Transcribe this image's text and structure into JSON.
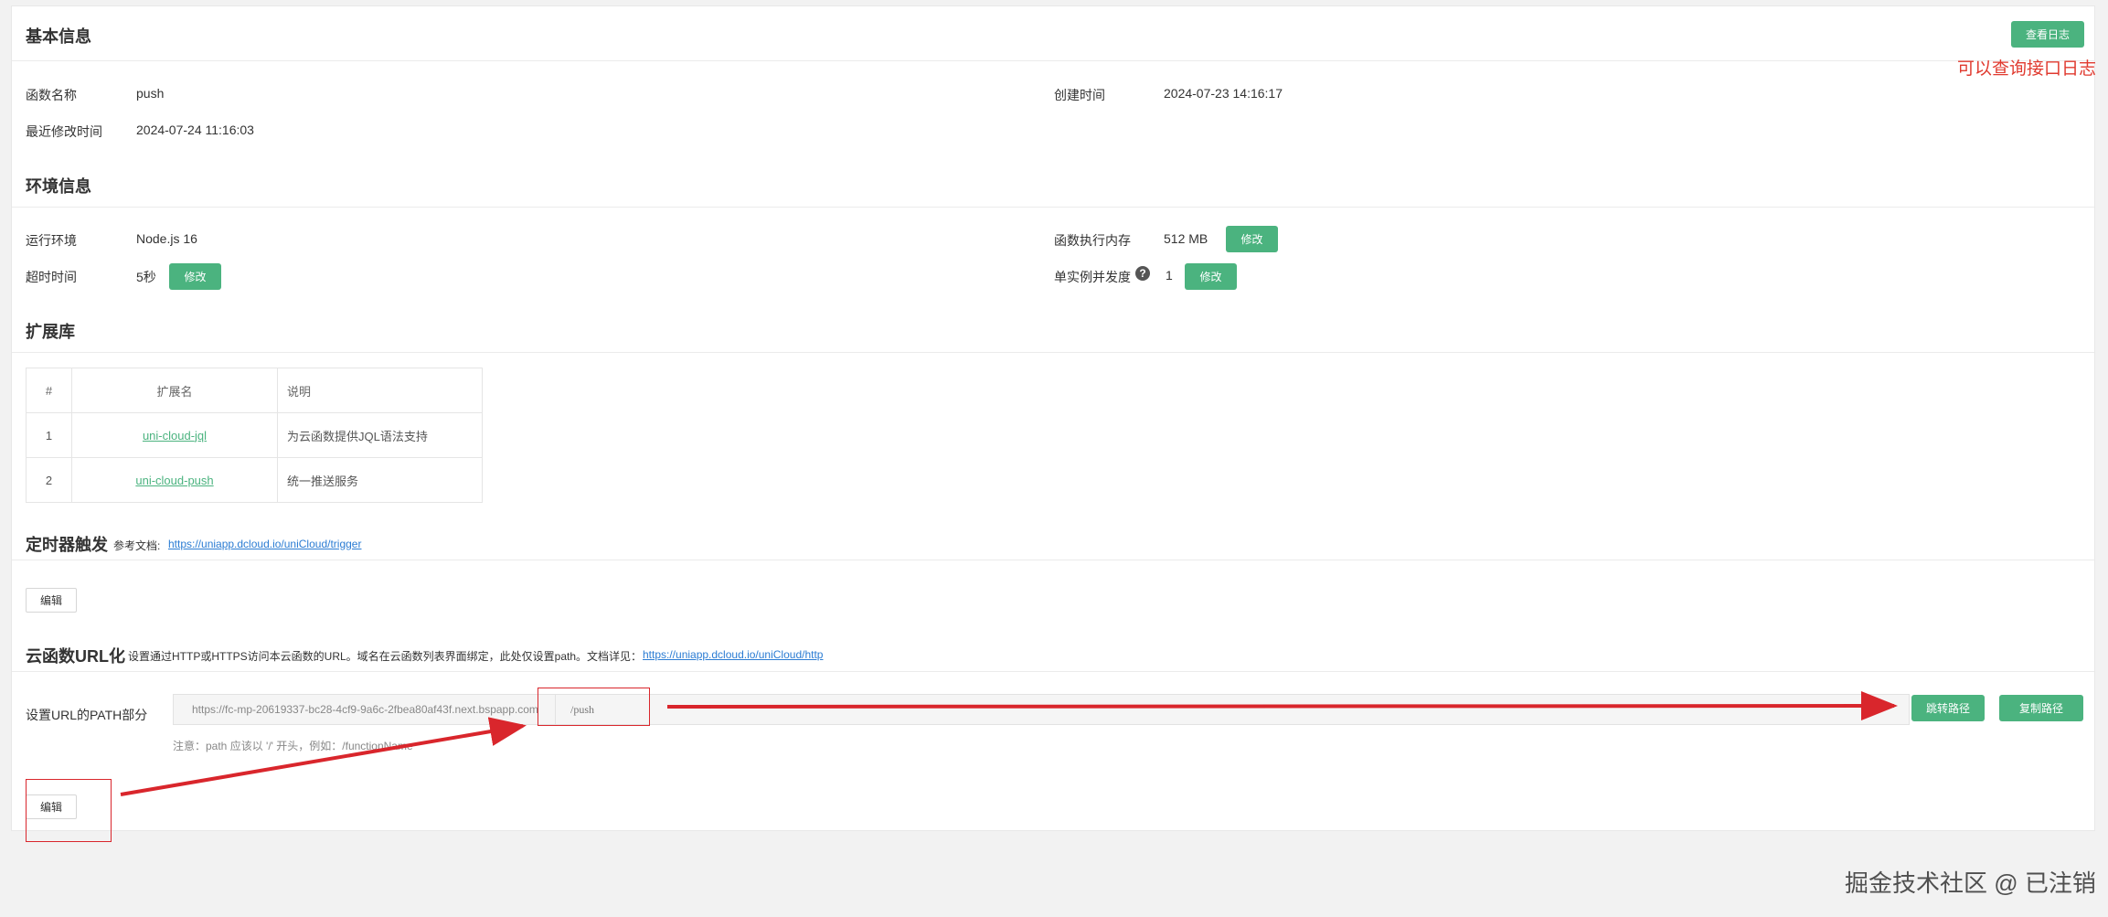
{
  "basic": {
    "title": "基本信息",
    "log_button": "查看日志",
    "func_name_label": "函数名称",
    "func_name_value": "push",
    "created_label": "创建时间",
    "created_value": "2024-07-23 14:16:17",
    "modified_label": "最近修改时间",
    "modified_value": "2024-07-24 11:16:03"
  },
  "env": {
    "title": "环境信息",
    "runtime_label": "运行环境",
    "runtime_value": "Node.js 16",
    "memory_label": "函数执行内存",
    "memory_value": "512 MB",
    "memory_edit": "修改",
    "timeout_label": "超时时间",
    "timeout_value": "5秒",
    "timeout_edit": "修改",
    "concurrency_label": "单实例并发度",
    "concurrency_value": "1",
    "concurrency_edit": "修改"
  },
  "ext": {
    "title": "扩展库",
    "headers": [
      "#",
      "扩展名",
      "说明"
    ],
    "rows": [
      {
        "index": "1",
        "name": "uni-cloud-jql",
        "desc": "为云函数提供JQL语法支持"
      },
      {
        "index": "2",
        "name": "uni-cloud-push",
        "desc": "统一推送服务"
      }
    ]
  },
  "timer": {
    "title": "定时器触发",
    "ref_label": "参考文档:",
    "ref_link": "https://uniapp.dcloud.io/uniCloud/trigger",
    "edit": "编辑"
  },
  "url": {
    "title": "云函数URL化",
    "desc": "设置通过HTTP或HTTPS访问本云函数的URL。域名在云函数列表界面绑定，此处仅设置path。文档详见：",
    "doc_link": "https://uniapp.dcloud.io/uniCloud/http",
    "path_label": "设置URL的PATH部分",
    "domain": "https://fc-mp-20619337-bc28-4cf9-9a6c-2fbea80af43f.next.bspapp.com",
    "path_value": "/push",
    "jump_button": "跳转路径",
    "copy_button": "复制路径",
    "note": "注意：path 应该以  '/'  开头，例如：/functionName",
    "edit": "编辑"
  },
  "annotations": {
    "log_note": "可以查询接口日志",
    "watermark": "掘金技术社区 @ 已注销"
  },
  "colors": {
    "accent": "#4bb37f",
    "annotation_red": "#d9262c",
    "link_blue": "#2b7cd3"
  }
}
